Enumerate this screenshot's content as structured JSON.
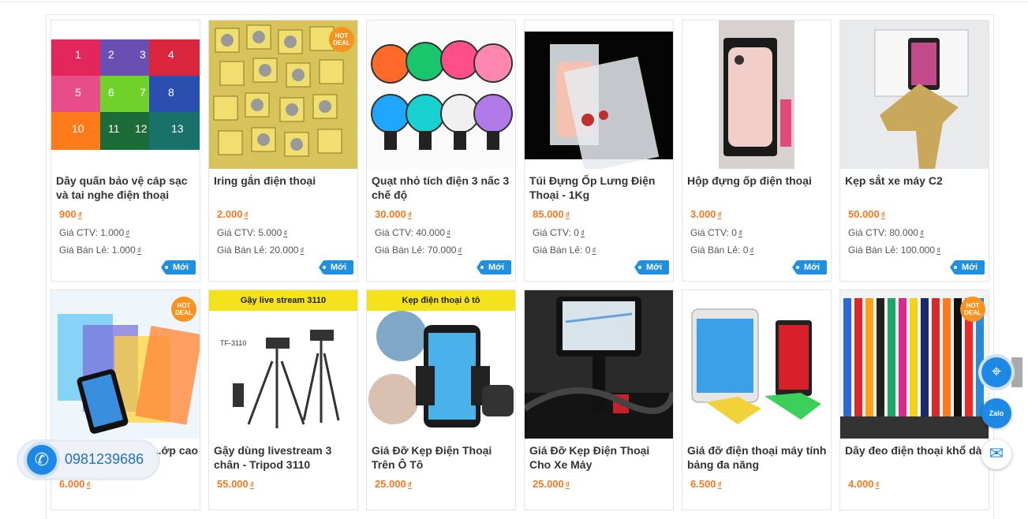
{
  "products": [
    {
      "title": "Dây quấn bảo vệ cáp sạc và tai nghe điện thoại",
      "price": "900",
      "ctv": "1.000",
      "retail": "1.000",
      "badge": "Mới",
      "hot": false,
      "image_labels": [
        "1",
        "2",
        "3",
        "4",
        "5",
        "6",
        "7",
        "8",
        "10",
        "11",
        "12",
        "13"
      ]
    },
    {
      "title": "Iring gắn điện thoại",
      "price": "2.000",
      "ctv": "5.000",
      "retail": "20.000",
      "badge": "Mới",
      "hot": true
    },
    {
      "title": "Quạt nhỏ tích điện 3 nấc 3 chế độ",
      "price": "30.000",
      "ctv": "40.000",
      "retail": "70.000",
      "badge": "Mới",
      "hot": false
    },
    {
      "title": "Túi Đựng Ốp Lưng Điện Thoại - 1Kg",
      "price": "85.000",
      "ctv": "0",
      "retail": "0",
      "badge": "Mới",
      "hot": false
    },
    {
      "title": "Hộp đựng ốp điện thoại",
      "price": "3.000",
      "ctv": "0",
      "retail": "0",
      "badge": "Mới",
      "hot": false
    },
    {
      "title": "Kẹp sắt xe máy C2",
      "price": "50.000",
      "ctv": "80.000",
      "retail": "100.000",
      "badge": "Mới",
      "hot": false
    },
    {
      "title": "...ớp cao",
      "price": "6.000",
      "hot": true
    },
    {
      "title": "Gậy dùng livestream 3 chân - Tripod 3110",
      "price": "55.000",
      "banner": "Gậy live stream 3110",
      "image_labels": [
        "TF-3110"
      ],
      "hot": false
    },
    {
      "title": "Giá Đỡ Kẹp Điện Thoại Trên Ô Tô",
      "price": "25.000",
      "banner": "Kẹp điện thoại ô tô",
      "hot": false
    },
    {
      "title": "Giá Đỡ Kẹp Điện Thoại Cho Xe Máy",
      "price": "25.000",
      "hot": false
    },
    {
      "title": "Giá đỡ điện thoại máy tính bảng đa năng",
      "price": "6.500",
      "hot": false
    },
    {
      "title": "Dây đeo điện thoại khổ dà",
      "price": "4.000",
      "hot": true
    }
  ],
  "labels": {
    "currency": "₫",
    "ctv_prefix": "Giá CTV: ",
    "retail_prefix": "Giá Bán Lẻ: ",
    "hot_deal": "HOT DEAL"
  },
  "contact": {
    "phone": "0981239686",
    "zalo": "Zalo"
  },
  "colors": {
    "price": "#f47920",
    "badge": "#1f8fe0",
    "accent": "#1e88e5"
  }
}
